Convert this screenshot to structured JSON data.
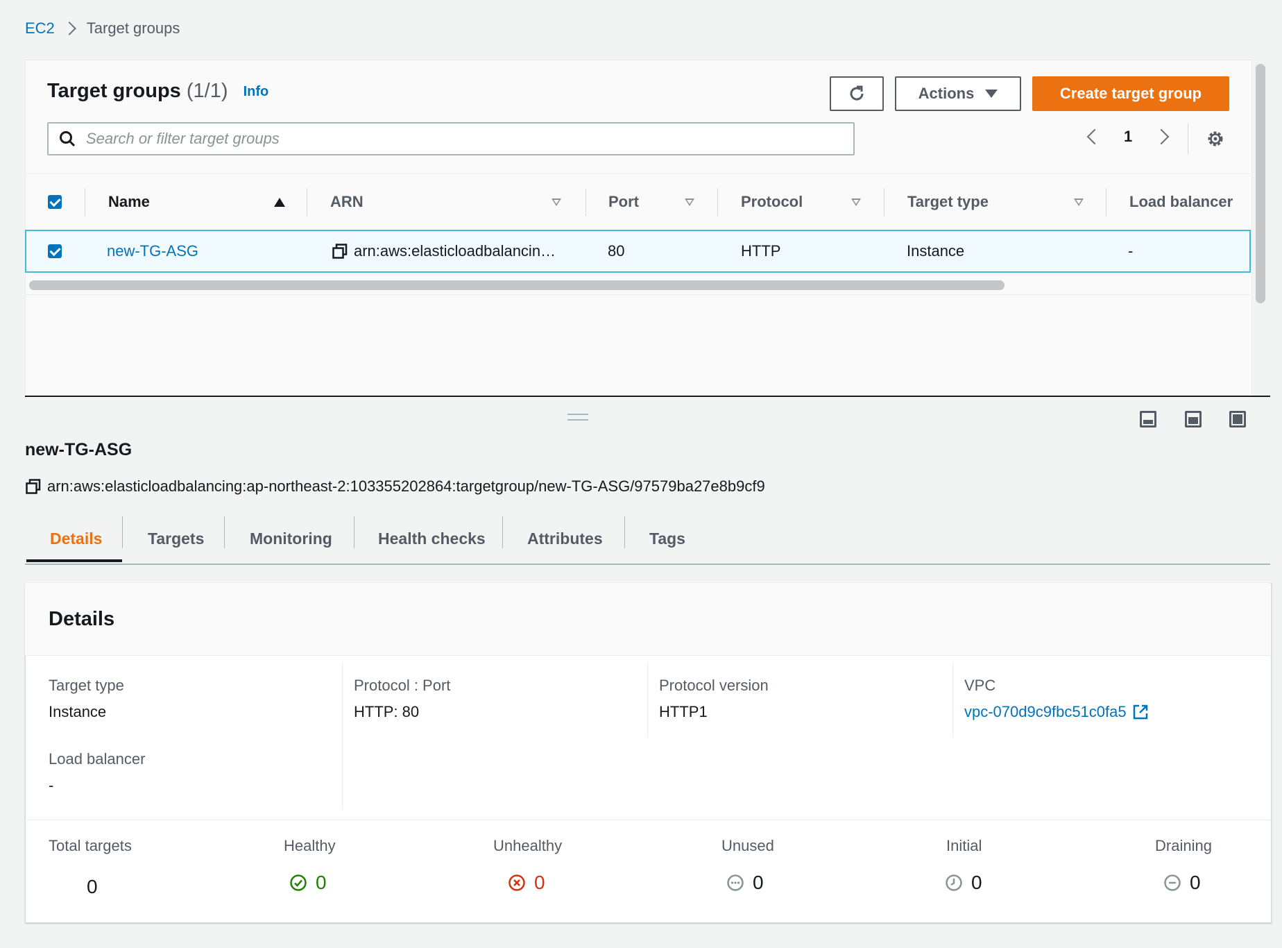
{
  "breadcrumb": {
    "root": "EC2",
    "current": "Target groups"
  },
  "panel": {
    "title": "Target groups",
    "count": "(1/1)",
    "info": "Info",
    "actions_label": "Actions",
    "create_label": "Create target group",
    "search_placeholder": "Search or filter target groups",
    "page": "1"
  },
  "table": {
    "columns": [
      "Name",
      "ARN",
      "Port",
      "Protocol",
      "Target type",
      "Load balancer"
    ],
    "rows": [
      {
        "name": "new-TG-ASG",
        "arn": "arn:aws:elasticloadbalancin…",
        "port": "80",
        "protocol": "HTTP",
        "target_type": "Instance",
        "load_balancer": "-"
      }
    ]
  },
  "detail": {
    "name": "new-TG-ASG",
    "arn": "arn:aws:elasticloadbalancing:ap-northeast-2:103355202864:targetgroup/new-TG-ASG/97579ba27e8b9cf9",
    "tabs": [
      "Details",
      "Targets",
      "Monitoring",
      "Health checks",
      "Attributes",
      "Tags"
    ],
    "active_tab": "Details",
    "card_title": "Details",
    "fields": {
      "target_type": {
        "label": "Target type",
        "value": "Instance"
      },
      "protocol_port": {
        "label": "Protocol : Port",
        "value": "HTTP: 80"
      },
      "protocol_version": {
        "label": "Protocol version",
        "value": "HTTP1"
      },
      "vpc": {
        "label": "VPC",
        "value": "vpc-070d9c9fbc51c0fa5"
      },
      "load_balancer": {
        "label": "Load balancer",
        "value": "-"
      }
    },
    "stats": {
      "total": {
        "label": "Total targets",
        "value": "0"
      },
      "healthy": {
        "label": "Healthy",
        "value": "0"
      },
      "unhealthy": {
        "label": "Unhealthy",
        "value": "0"
      },
      "unused": {
        "label": "Unused",
        "value": "0"
      },
      "initial": {
        "label": "Initial",
        "value": "0"
      },
      "draining": {
        "label": "Draining",
        "value": "0"
      }
    }
  },
  "colors": {
    "primary": "#ec7211",
    "link": "#0073bb",
    "healthy": "#1d8102",
    "unhealthy": "#d13212",
    "neutral": "#879596",
    "selected_row_border": "#44b9d6"
  },
  "icons": [
    "refresh-icon",
    "caret-down-icon",
    "search-icon",
    "chevron-left-icon",
    "chevron-right-icon",
    "gear-icon",
    "copy-icon",
    "external-link-icon",
    "status-healthy-icon",
    "status-unhealthy-icon",
    "status-unused-icon",
    "status-initial-icon",
    "status-draining-icon"
  ]
}
